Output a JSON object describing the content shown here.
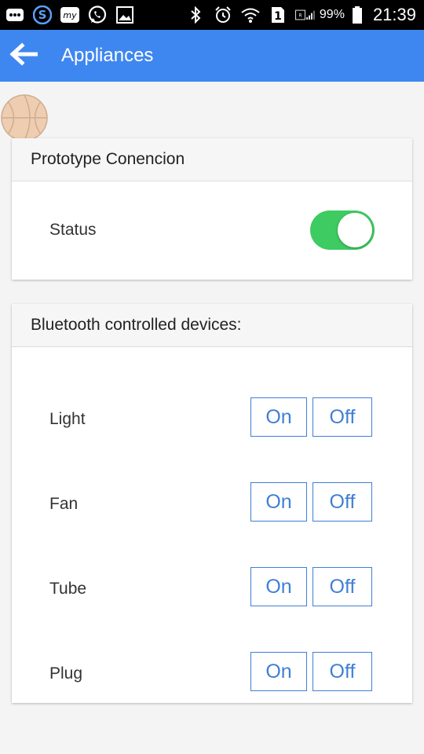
{
  "status_bar": {
    "battery": "99%",
    "time": "21:39",
    "sim_label": "1"
  },
  "app_bar": {
    "title": "Appliances"
  },
  "connection_card": {
    "header": "Prototype Conencion",
    "status_label": "Status",
    "status_on": true
  },
  "devices_card": {
    "header": "Bluetooth controlled devices:",
    "devices": [
      {
        "label": "Light",
        "on_label": "On",
        "off_label": "Off"
      },
      {
        "label": "Fan",
        "on_label": "On",
        "off_label": "Off"
      },
      {
        "label": "Tube",
        "on_label": "On",
        "off_label": "Off"
      },
      {
        "label": "Plug",
        "on_label": "On",
        "off_label": "Off"
      }
    ]
  },
  "colors": {
    "app_bar": "#3f87f0",
    "toggle_on": "#3ecb61",
    "button_accent": "#3f7fd4"
  }
}
